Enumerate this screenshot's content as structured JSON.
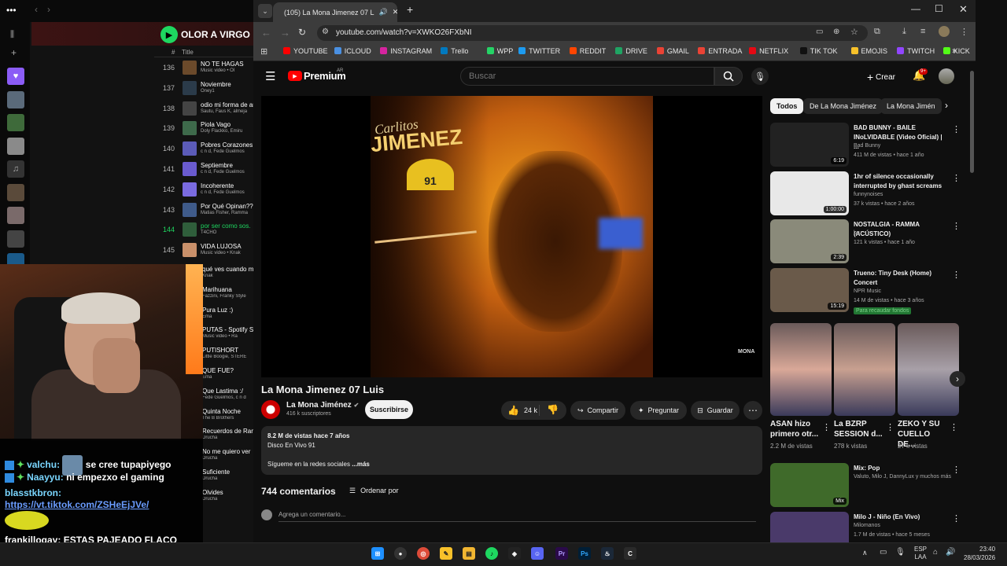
{
  "spotify": {
    "playlist_name": "OLOR A VIRGO",
    "col_num": "#",
    "col_title": "Title",
    "tracks": [
      {
        "num": "136",
        "title": "NO TE HAGAS",
        "artist": "Music video • Ol",
        "color": "#6b4a2b"
      },
      {
        "num": "137",
        "title": "Noviembre",
        "artist": "Oney1",
        "color": "#2b3b4a"
      },
      {
        "num": "138",
        "title": "odio mi forma de am",
        "artist": "Sautu, Faus K, almeja",
        "color": "#444"
      },
      {
        "num": "139",
        "title": "Piola Vago",
        "artist": "Doly Flackko, Emiru",
        "color": "#3e6a4b"
      },
      {
        "num": "140",
        "title": "Pobres Corazones",
        "artist": "c n d, Fede Guelmos",
        "color": "#5b5bb8"
      },
      {
        "num": "141",
        "title": "Septiembre",
        "artist": "c n d, Fede Guelmos",
        "color": "#6a5bcf"
      },
      {
        "num": "142",
        "title": "Incoherente",
        "artist": "c n d, Fede Guelmos",
        "color": "#7a6be0"
      },
      {
        "num": "143",
        "title": "Por Qué Opinan???",
        "artist": "Matias Fisher, Ramma",
        "color": "#3f5b8a"
      },
      {
        "num": "144",
        "title": "por ser como sos.",
        "artist": "T4CHO",
        "color": "#2f5e3b",
        "active": true
      },
      {
        "num": "145",
        "title": "VIDA LUJOSA",
        "artist": "Music video • Knak",
        "color": "#c9906a"
      }
    ],
    "tracks_partial": [
      {
        "title": "qué ves cuando me",
        "artist": "Knak"
      },
      {
        "title": "Marihuana",
        "artist": "Fazzini, Franky Style"
      },
      {
        "title": "Pura Luz :)",
        "artist": "Ema"
      },
      {
        "title": "PUTAS - Spotify Sess",
        "artist": "Music video • Ra"
      },
      {
        "title": "PUTISHORT",
        "artist": "Little Boogie, STERE"
      },
      {
        "title": "QUE FUE?",
        "artist": "Ema"
      },
      {
        "title": "Que Lastima :/",
        "artist": "Fede Guelmos, c n d"
      },
      {
        "title": "Quinta Noche",
        "artist": "The B Brothers"
      },
      {
        "title": "Recuerdos de Ramir",
        "artist": "Drucha"
      },
      {
        "title": "No me quiero ver",
        "artist": "Drucha"
      },
      {
        "title": "Suficiente",
        "artist": "Drucha"
      },
      {
        "title": "Olvides",
        "artist": "Drucha"
      }
    ]
  },
  "chat": [
    {
      "user": "valchu:",
      "msg": "se cree tupapiyego"
    },
    {
      "user": "Naayyu:",
      "msg": "ni empezxo el gaming"
    },
    {
      "user": "blasstkbron:",
      "link": "https://vt.tiktok.com/ZSHeEjJVe/"
    },
    {
      "user": "frankillogay:",
      "msg": "ESTAS PAJEADO FLACO"
    }
  ],
  "chrome": {
    "tab_title": "(105) La Mona Jimenez 07 L",
    "url": "youtube.com/watch?v=XWKO26FXbNI",
    "bookmarks": [
      {
        "label": "YOUTUBE",
        "color": "#ff0000"
      },
      {
        "label": "ICLOUD",
        "color": "#4a90e2"
      },
      {
        "label": "INSTAGRAM",
        "color": "#d6249f"
      },
      {
        "label": "Trello",
        "color": "#0079bf"
      },
      {
        "label": "WPP",
        "color": "#25d366"
      },
      {
        "label": "TWITTER",
        "color": "#1d9bf0"
      },
      {
        "label": "REDDIT",
        "color": "#ff4500"
      },
      {
        "label": "DRIVE",
        "color": "#1fa463"
      },
      {
        "label": "GMAIL",
        "color": "#ea4335"
      },
      {
        "label": "ENTRADA",
        "color": "#ea4335"
      },
      {
        "label": "NETFLIX",
        "color": "#e50914"
      },
      {
        "label": "TIK TOK",
        "color": "#111111"
      },
      {
        "label": "EMOJIS",
        "color": "#f7c12a"
      },
      {
        "label": "TWITCH",
        "color": "#9146ff"
      },
      {
        "label": "KICK",
        "color": "#53fc18"
      }
    ]
  },
  "youtube": {
    "logo": "Premium",
    "region": "AR",
    "search_placeholder": "Buscar",
    "create": "Crear",
    "notif_count": "9+",
    "video_title": "La Mona Jimenez 07 Luis",
    "channel_name": "La Mona Jiménez",
    "subscribers": "416 k suscriptores",
    "subscribe": "Suscribirse",
    "likes": "24 k",
    "share": "Compartir",
    "ask": "Preguntar",
    "save": "Guardar",
    "views": "8.2 M de vistas  hace 7 años",
    "desc_line1": "Disco En Vivo 91",
    "desc_line2": "Sígueme en la redes sociales",
    "more": "...más",
    "comments_count": "744 comentarios",
    "sort": "Ordenar por",
    "add_comment": "Agrega un comentario...",
    "video_overlay_text1": "Carlitos",
    "video_overlay_text2": "JIMENEZ",
    "video_overlay_badge": "91",
    "watermark": "MONA",
    "chips": [
      "Todos",
      "De La Mona Jiménez",
      "La Mona Jimén"
    ],
    "recs": [
      {
        "title": "BAD BUNNY - BAILE INoLVIDABLE (Video Oficial) | ...",
        "channel": "Bad Bunny",
        "meta": "411 M de vistas • hace 1 año",
        "dur": "6:19",
        "thumb": "#222",
        "verified": true
      },
      {
        "title": "1hr of silence occasionally interrupted by ghast screams",
        "channel": "funnynoises",
        "meta": "37 k vistas • hace 2 años",
        "dur": "1:00:00",
        "thumb": "#e8e8e8"
      },
      {
        "title": "NOSTALGIA - RAMMA (ACÚSTICO)",
        "channel": "bru",
        "meta": "121 k vistas • hace 1 año",
        "dur": "2:39",
        "thumb": "#8a8a7a"
      },
      {
        "title": "Trueno: Tiny Desk (Home) Concert",
        "channel": "NPR Music",
        "meta": "14 M de vistas • hace 3 años",
        "dur": "15:19",
        "thumb": "#6a5a4a",
        "verified": true,
        "badge": "Para recaudar fondos"
      }
    ],
    "shorts": [
      {
        "title": "ASAN hizo primero otr...",
        "views": "2.2 M de vistas"
      },
      {
        "title": "La BZRP SESSION d...",
        "views": "278 k vistas"
      },
      {
        "title": "ZEKO Y SU CUELLO DE...",
        "views": "27 k vistas"
      }
    ],
    "recs2": [
      {
        "title": "Mix: Pop",
        "channel": "Valuto, Milo J, DannyLux y muchos más",
        "meta": "",
        "dur": "Mix",
        "thumb": "#3f6a2a"
      },
      {
        "title": "Milo J - Niño (En Vivo)",
        "channel": "Milomanos",
        "meta": "1.7 M de vistas • hace 5 meses",
        "dur": "",
        "thumb": "#4a3a6a"
      }
    ]
  },
  "taskbar": {
    "lang1": "ESP",
    "lang2": "LAA",
    "time": "23:40",
    "date": "28/03/2026"
  }
}
